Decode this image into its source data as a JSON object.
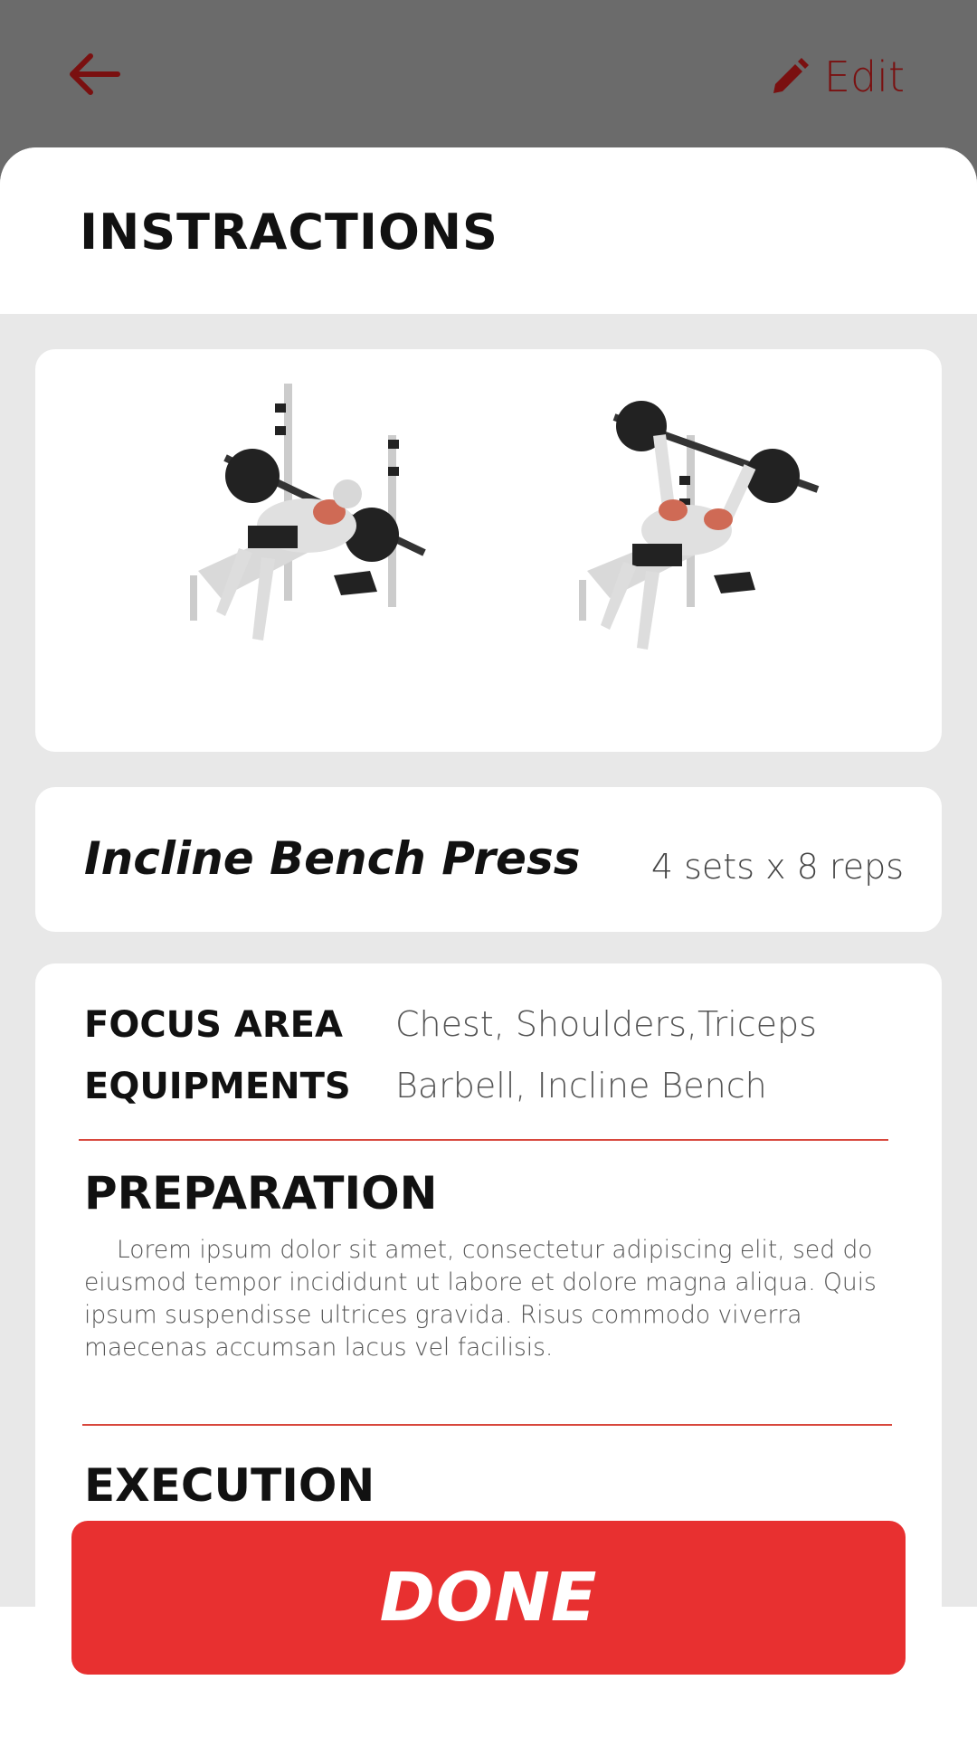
{
  "header": {
    "back_icon": "arrow-left-icon",
    "edit_icon": "pencil-icon",
    "edit_label": "Edit"
  },
  "sheet": {
    "title": "INSTRACTIONS"
  },
  "exercise": {
    "name": "Incline Bench Press",
    "sets_reps": "4 sets x 8 reps"
  },
  "details": {
    "focus_label": "FOCUS AREA",
    "focus_value": "Chest, Shoulders,Triceps",
    "equip_label": "EQUIPMENTS",
    "equip_value": "Barbell, Incline Bench"
  },
  "preparation": {
    "title": "PREPARATION",
    "text": "Lorem ipsum dolor sit amet, consectetur adipiscing elit, sed do eiusmod tempor incididunt ut labore et dolore magna aliqua. Quis ipsum suspendisse ultrices gravida. Risus commodo viverra maecenas accumsan lacus vel facilisis."
  },
  "execution": {
    "title": "EXECUTION"
  },
  "done_button": {
    "label": "DONE"
  },
  "colors": {
    "accent": "#e83030",
    "header_bg": "#6b6b6b",
    "icon_dark_red": "#7a1010"
  }
}
